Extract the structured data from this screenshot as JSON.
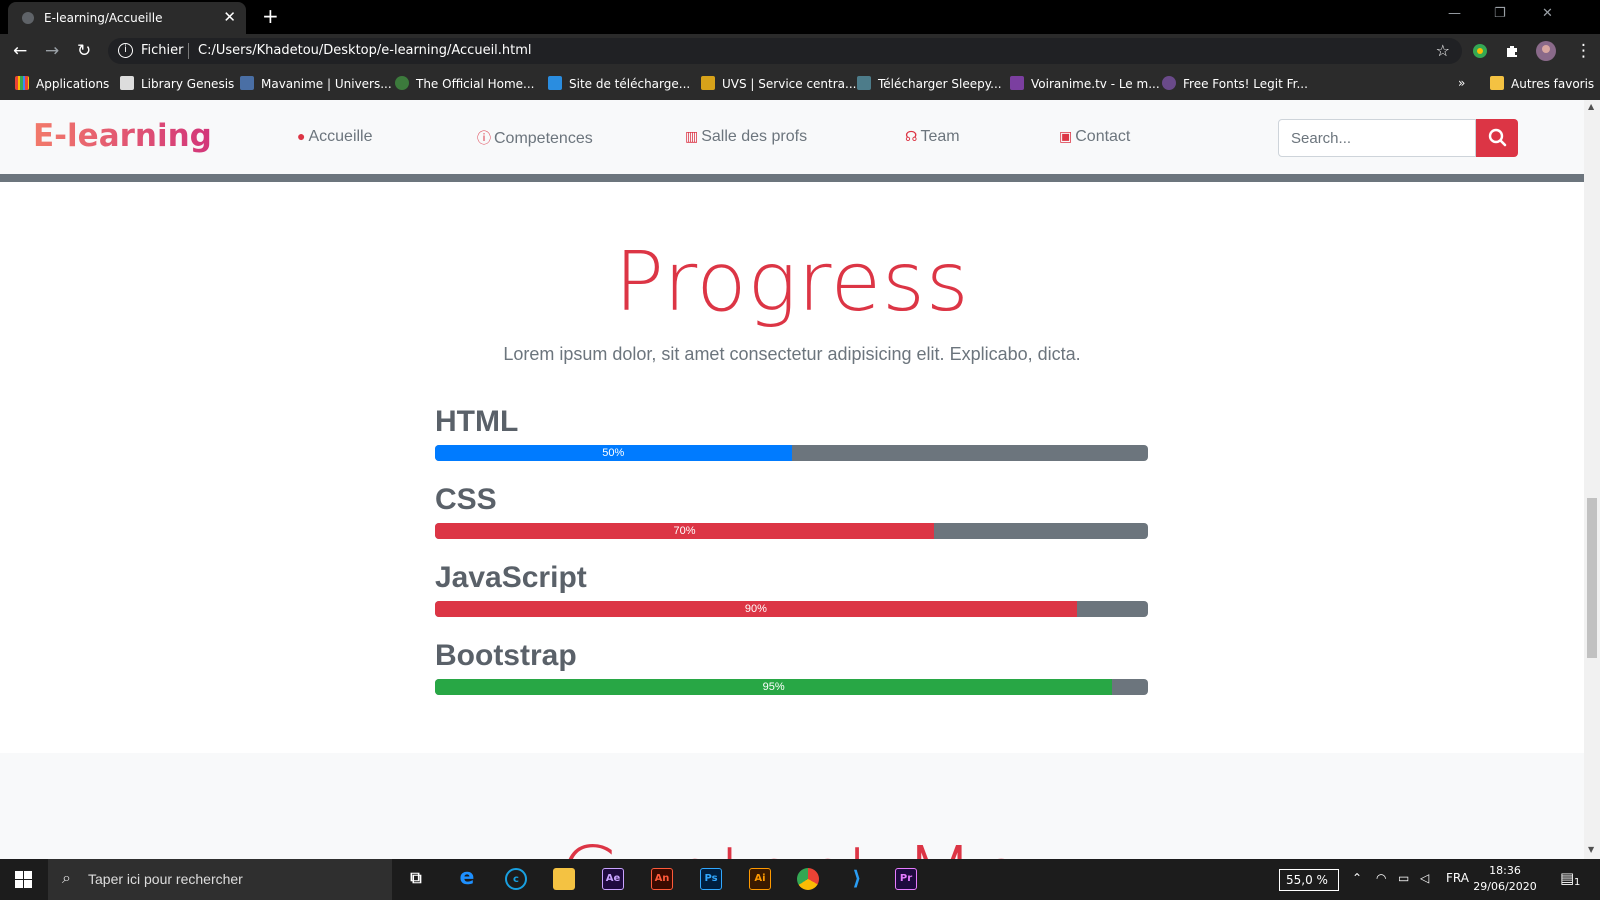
{
  "browser": {
    "tab_title": "E-learning/Accueille",
    "address_prefix": "Fichier",
    "url": "C:/Users/Khadetou/Desktop/e-learning/Accueil.html",
    "bookmarks": [
      "Applications",
      "Library Genesis",
      "Mavanime | Univers...",
      "The Official Home...",
      "Site de télécharge...",
      "UVS | Service centra...",
      "Télécharger Sleepy...",
      "Voiranime.tv - Le m...",
      "Free Fonts! Legit Fr..."
    ],
    "other_bookmarks": "Autres favoris",
    "overflow": "»"
  },
  "navbar": {
    "brand": "E-learning",
    "links": [
      "Accueille",
      "Competences",
      "Salle des profs",
      "Team",
      "Contact"
    ],
    "search_placeholder": "Search..."
  },
  "progress_section": {
    "title": "Progress",
    "subtitle": "Lorem ipsum dolor, sit amet consectetur adipisicing elit. Explicabo, dicta.",
    "skills": [
      {
        "name": "HTML",
        "percent": 50,
        "label": "50%",
        "color": "#007bff"
      },
      {
        "name": "CSS",
        "percent": 70,
        "label": "70%",
        "color": "#dc3545"
      },
      {
        "name": "JavaScript",
        "percent": 90,
        "label": "90%",
        "color": "#dc3545"
      },
      {
        "name": "Bootstrap",
        "percent": 95,
        "label": "95%",
        "color": "#28a745"
      }
    ]
  },
  "next_section_title": "Contact Me",
  "colors": {
    "accent": "#dc3545",
    "muted": "#6c757d"
  },
  "taskbar": {
    "search_text": "Taper ici pour rechercher",
    "zoom": "55,0 %",
    "lang": "FRA",
    "time": "18:36",
    "date": "29/06/2020",
    "notifications": "1"
  }
}
